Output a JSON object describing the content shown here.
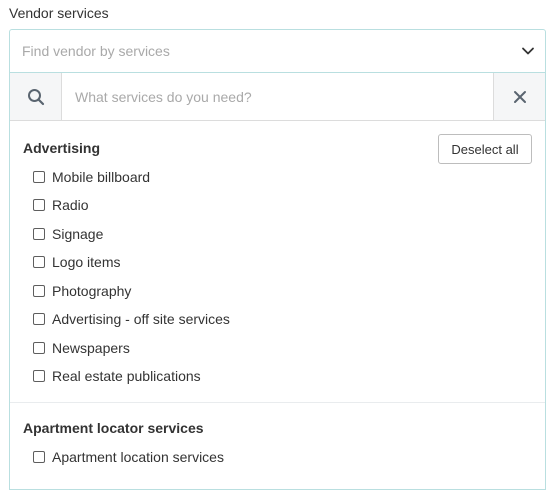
{
  "field": {
    "label": "Vendor services",
    "placeholder": "Find vendor by services"
  },
  "search": {
    "placeholder": "What services do you need?"
  },
  "actions": {
    "deselect_all": "Deselect all"
  },
  "groups": [
    {
      "title": "Advertising",
      "options": [
        {
          "label": "Mobile billboard",
          "checked": false
        },
        {
          "label": "Radio",
          "checked": false
        },
        {
          "label": "Signage",
          "checked": false
        },
        {
          "label": "Logo items",
          "checked": false
        },
        {
          "label": "Photography",
          "checked": false
        },
        {
          "label": "Advertising - off site services",
          "checked": false
        },
        {
          "label": "Newspapers",
          "checked": false
        },
        {
          "label": "Real estate publications",
          "checked": false
        }
      ]
    },
    {
      "title": "Apartment locator services",
      "options": [
        {
          "label": "Apartment location services",
          "checked": false
        }
      ]
    }
  ],
  "colors": {
    "accent_border": "#b9dfe0",
    "icon": "#5a6570"
  },
  "icons": [
    "chevron-down-icon",
    "search-icon",
    "close-icon"
  ]
}
